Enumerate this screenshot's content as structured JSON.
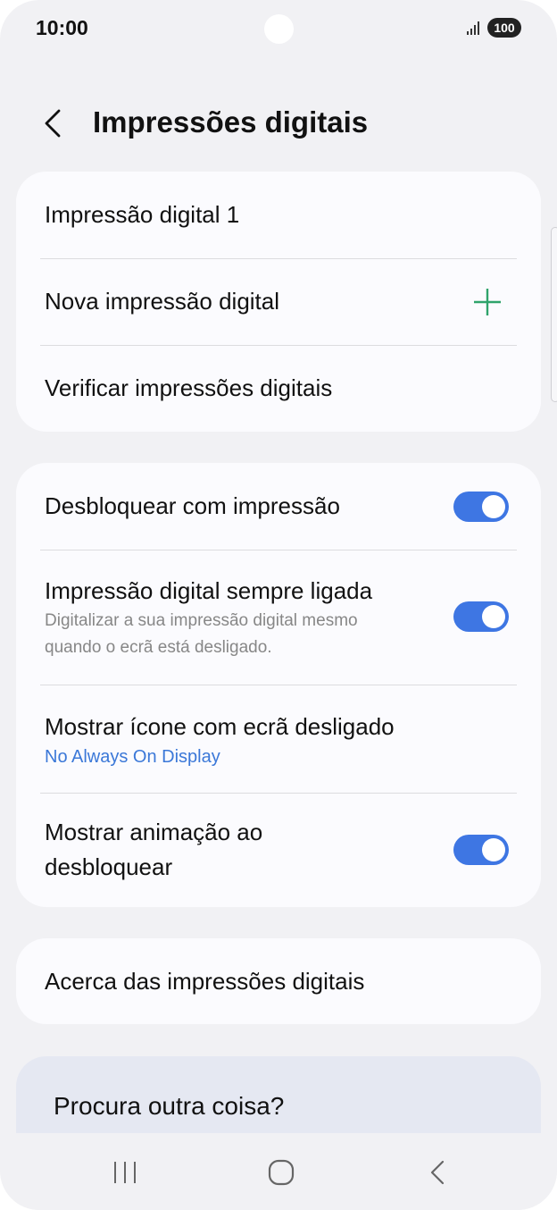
{
  "status_bar": {
    "time": "10:00",
    "battery": "100"
  },
  "header": {
    "title": "Impressões digitais"
  },
  "fingerprints": {
    "items": [
      {
        "label": "Impressão digital 1"
      },
      {
        "label": "Nova impressão digital"
      },
      {
        "label": "Verificar impressões digitais"
      }
    ]
  },
  "settings": {
    "unlock": {
      "label": "Desbloquear com impressão",
      "enabled": true
    },
    "always_on": {
      "label": "Impressão digital sempre ligada",
      "description_line1": "Digitalizar a sua impressão digital mesmo",
      "description_line2": "quando o ecrã está desligado.",
      "enabled": true
    },
    "screen_off_icon": {
      "label": "Mostrar ícone com ecrã desligado",
      "value": "No Always On Display"
    },
    "animation": {
      "label_line1": "Mostrar animação ao",
      "label_line2": "desbloquear",
      "enabled": true
    }
  },
  "about": {
    "label": "Acerca das impressões digitais"
  },
  "search_suggestion": {
    "label": "Procura outra coisa?"
  },
  "colors": {
    "accent": "#3e76e3",
    "plus_icon": "#2fa36b",
    "link": "#3b78d8",
    "background": "#f1f1f4",
    "card": "#fbfbfe"
  },
  "icons": {
    "back": "chevron-left-icon",
    "add": "plus-icon",
    "nav_recents": "recents-icon",
    "nav_home": "home-icon",
    "nav_back": "back-icon"
  }
}
